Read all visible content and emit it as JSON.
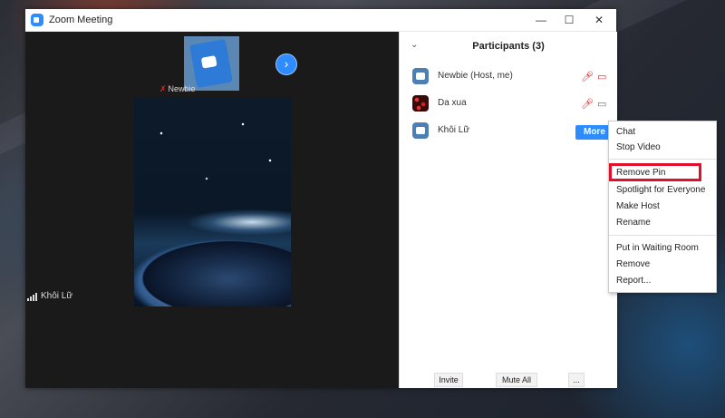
{
  "window": {
    "title": "Zoom Meeting",
    "controls": {
      "minimize": "—",
      "maximize": "☐",
      "close": "✕"
    },
    "icon": "zoom-logo-icon"
  },
  "video": {
    "thumbnail_name": "Newbie",
    "active_speaker": "Khôi Lữ",
    "next_icon": "chevron-right-icon"
  },
  "participants_panel": {
    "title": "Participants (3)",
    "collapse_icon": "chevron-down-icon",
    "participants": [
      {
        "name": "Newbie (Host, me)",
        "avatar": "zoom-avatar",
        "mic": "muted",
        "video": "off"
      },
      {
        "name": "Da xua",
        "avatar": "red-avatar",
        "mic": "muted",
        "video": "on"
      },
      {
        "name": "Khôi Lữ",
        "avatar": "zoom-avatar",
        "action": "More"
      }
    ],
    "more_label": "More",
    "footer": {
      "invite": "Invite",
      "mute_all": "Mute All",
      "more": "..."
    }
  },
  "context_menu": {
    "items": [
      "Chat",
      "Stop Video",
      "Remove Pin",
      "Spotlight for Everyone",
      "Make Host",
      "Rename",
      "Put in Waiting Room",
      "Remove",
      "Report..."
    ],
    "highlighted": "Remove Pin"
  },
  "colors": {
    "accent": "#2d8cff",
    "highlight_border": "#e0102a",
    "muted": "#e02828"
  }
}
